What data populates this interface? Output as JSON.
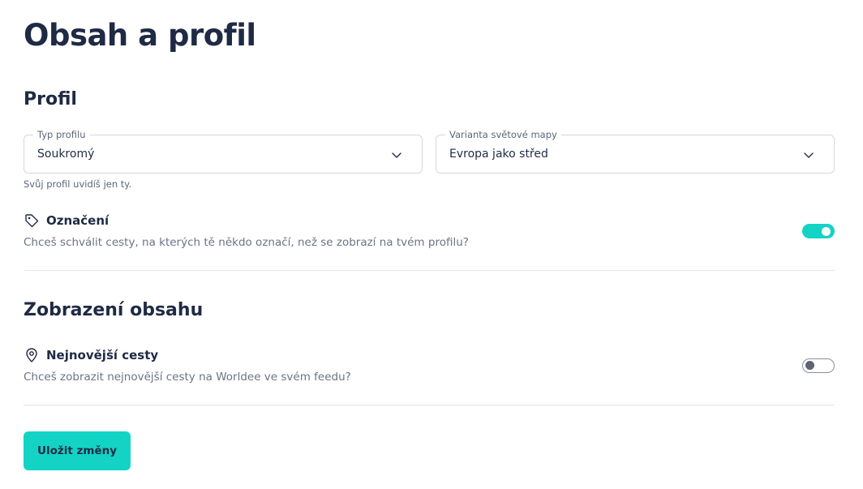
{
  "page": {
    "title": "Obsah a profil"
  },
  "profile_section": {
    "title": "Profil",
    "profile_type": {
      "label": "Typ profilu",
      "value": "Soukromý"
    },
    "map_variant": {
      "label": "Varianta světové mapy",
      "value": "Evropa jako střed"
    },
    "helper": "Svůj profil uvidíš jen ty.",
    "tagging": {
      "title": "Označení",
      "description": "Chceš schválit cesty, na kterých tě někdo označí, než se zobrazí na tvém profilu?",
      "enabled": true,
      "icon": "tag-icon"
    }
  },
  "content_section": {
    "title": "Zobrazení obsahu",
    "newest_trips": {
      "title": "Nejnovější cesty",
      "description": "Chceš zobrazit nejnovější cesty na Worldee ve svém feedu?",
      "enabled": false,
      "icon": "map-pin-icon"
    }
  },
  "actions": {
    "save_label": "Uložit změny"
  },
  "colors": {
    "accent": "#13d3c5",
    "text": "#1f2a44",
    "muted": "#6b7385",
    "border": "#d3d7de"
  }
}
